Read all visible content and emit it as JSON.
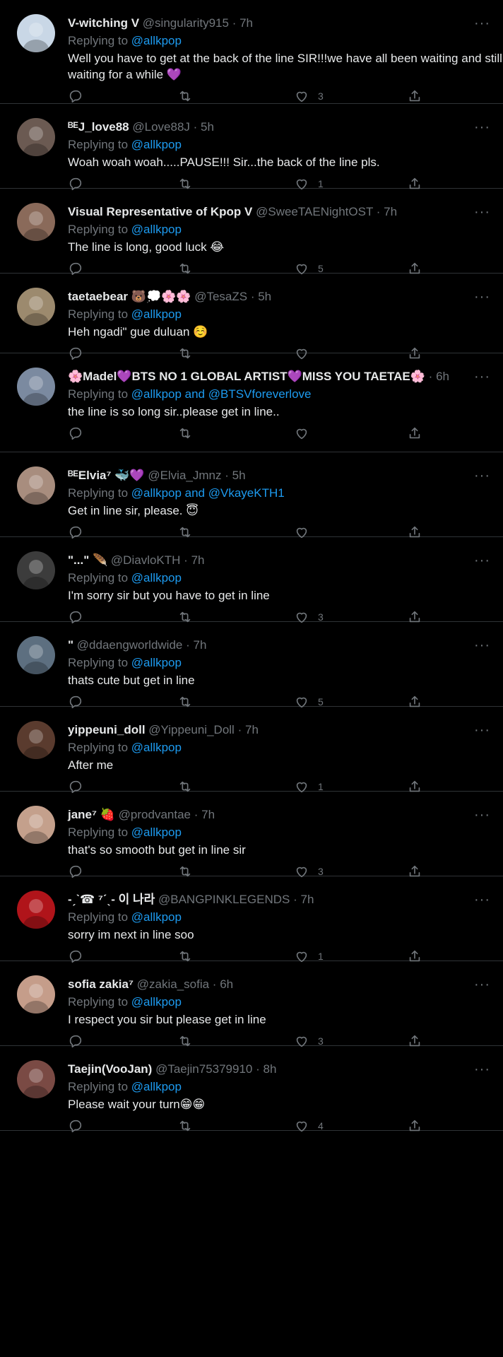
{
  "tweets": [
    {
      "name": "V-witching V",
      "handle": "@singularity915",
      "dot": "·",
      "time": "7h",
      "replying_label": "Replying to",
      "mentions": "@allkpop",
      "text": "Well you have to get at the back of the line SIR!!!we have all been waiting and still waiting for a while 💜",
      "likes": "3",
      "avatar_color": "#c9d7e6"
    },
    {
      "name": "ᴮᴱJ_love88",
      "handle": "@Love88J",
      "dot": "·",
      "time": "5h",
      "replying_label": "Replying to",
      "mentions": "@allkpop",
      "text": "Woah woah woah.....PAUSE!!! Sir...the back of the line pls.",
      "likes": "1",
      "avatar_color": "#6b5a52"
    },
    {
      "name": "Visual Representative of Kpop V",
      "handle": "@SweeTAENightOST",
      "dot": "·",
      "time": "7h",
      "replying_label": "Replying to",
      "mentions": "@allkpop",
      "text": "The line is long, good luck 😂",
      "likes": "5",
      "avatar_color": "#8a6a5a"
    },
    {
      "name": "taetaebear 🐻💭🌸🌸",
      "handle": "@TesaZS",
      "dot": "·",
      "time": "5h",
      "replying_label": "Replying to",
      "mentions": "@allkpop",
      "text": "Heh ngadi\" gue duluan ☺️",
      "likes": "",
      "avatar_color": "#9c8a6e"
    },
    {
      "name": "🌸Madel💜BTS NO 1 GLOBAL ARTIST💜MISS YOU TAETAE🌸",
      "handle": "",
      "dot": "·",
      "time": "6h",
      "replying_label": "Replying to",
      "mentions": "@allkpop and @BTSVforeverlove",
      "text": "the line is so long sir..please get in line..",
      "likes": "",
      "avatar_color": "#7b8aa0"
    },
    {
      "name": "ᴮᴱElvia⁷ 🐳💜",
      "handle": "@Elvia_Jmnz",
      "dot": "·",
      "time": "5h",
      "replying_label": "Replying to",
      "mentions": "@allkpop and @VkayeKTH1",
      "text": "Get in line sir, please. 😇",
      "likes": "",
      "avatar_color": "#a88d7e"
    },
    {
      "name": "\"...\" 🪶",
      "handle": "@DiavloKTH",
      "dot": "·",
      "time": "7h",
      "replying_label": "Replying to",
      "mentions": "@allkpop",
      "text": "I'm sorry sir but you have to get in line",
      "likes": "3",
      "avatar_color": "#3c3c3c"
    },
    {
      "name": "\"",
      "handle": "@ddaengworldwide",
      "dot": "·",
      "time": "7h",
      "replying_label": "Replying to",
      "mentions": "@allkpop",
      "text": "thats cute but get in line",
      "likes": "5",
      "avatar_color": "#5d6f80"
    },
    {
      "name": "yippeuni_doll",
      "handle": "@Yippeuni_Doll",
      "dot": "·",
      "time": "7h",
      "replying_label": "Replying to",
      "mentions": "@allkpop",
      "text": "After me",
      "likes": "1",
      "avatar_color": "#5a3b2e"
    },
    {
      "name": "jane⁷ 🍓",
      "handle": "@prodvantae",
      "dot": "·",
      "time": "7h",
      "replying_label": "Replying to",
      "mentions": "@allkpop",
      "text": "that's so smooth but get in line sir",
      "likes": "3",
      "avatar_color": "#c4a08c"
    },
    {
      "name": "-ˏˋ☎ ⁷ˊˎ- 이 나라",
      "handle": "@BANGPINKLEGENDS",
      "dot": "·",
      "time": "7h",
      "replying_label": "Replying to",
      "mentions": "@allkpop",
      "text": "sorry im next in line soo",
      "likes": "1",
      "avatar_color": "#b0141a"
    },
    {
      "name": "sofia zakia⁷",
      "handle": "@zakia_sofia",
      "dot": "·",
      "time": "6h",
      "replying_label": "Replying to",
      "mentions": "@allkpop",
      "text": "I respect you sir but please get in line",
      "likes": "3",
      "avatar_color": "#c59d8a"
    },
    {
      "name": "Taejin(VooJan)",
      "handle": "@Taejin75379910",
      "dot": "·",
      "time": "8h",
      "replying_label": "Replying to",
      "mentions": "@allkpop",
      "text": "Please wait your turn😁😁",
      "likes": "4",
      "avatar_color": "#7a4a44"
    }
  ]
}
